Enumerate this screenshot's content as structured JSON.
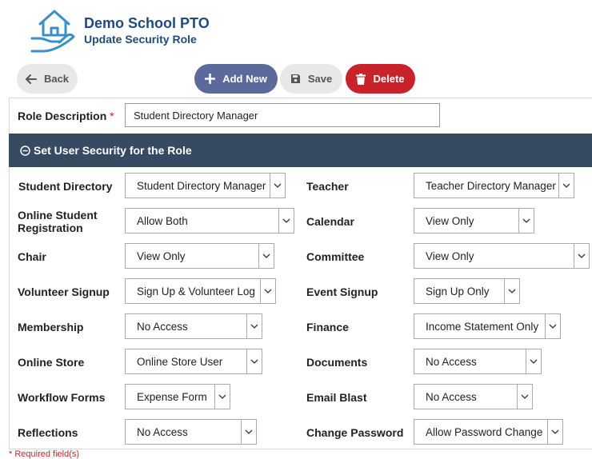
{
  "header": {
    "school_name": "Demo School PTO",
    "page_title": "Update Security Role"
  },
  "toolbar": {
    "back_label": "Back",
    "add_label": "Add New",
    "save_label": "Save",
    "delete_label": "Delete"
  },
  "form": {
    "role_description_label": "Role Description",
    "required_mark": "*",
    "role_description_value": "Student Directory Manager",
    "section_title": "Set User Security for the Role",
    "fields": {
      "student_directory": {
        "label": "Student Directory",
        "value": "Student Directory Manager"
      },
      "teacher": {
        "label": "Teacher",
        "value": "Teacher Directory Manager"
      },
      "online_student_registration": {
        "label_line1": "Online Student",
        "label_line2": "Registration",
        "value": "Allow Both"
      },
      "calendar": {
        "label": "Calendar",
        "value": "View Only"
      },
      "chair": {
        "label": "Chair",
        "value": "View Only"
      },
      "committee": {
        "label": "Committee",
        "value": "View Only"
      },
      "volunteer_signup": {
        "label": "Volunteer Signup",
        "value": "Sign Up & Volunteer Log"
      },
      "event_signup": {
        "label": "Event Signup",
        "value": "Sign Up Only"
      },
      "membership": {
        "label": "Membership",
        "value": "No Access"
      },
      "finance": {
        "label": "Finance",
        "value": "Income Statement Only"
      },
      "online_store": {
        "label": "Online Store",
        "value": "Online Store User"
      },
      "documents": {
        "label": "Documents",
        "value": "No Access"
      },
      "workflow_forms": {
        "label": "Workflow Forms",
        "value": "Expense Form"
      },
      "email_blast": {
        "label": "Email Blast",
        "value": "No Access"
      },
      "reflections": {
        "label": "Reflections",
        "value": "No Access"
      },
      "change_password": {
        "label": "Change Password",
        "value": "Allow Password Change"
      }
    }
  },
  "footer": {
    "note": "* Required field(s)"
  },
  "colors": {
    "brand_text": "#1e4b7a",
    "add_button": "#5b6a9a",
    "delete_button": "#c8232a",
    "section_bar": "#364a61",
    "logo": "#3a8fc9"
  },
  "icons": {
    "logo": "house-in-hand-logo",
    "back": "arrow-left-icon",
    "add": "plus-icon",
    "save": "floppy-disk-icon",
    "delete": "trash-icon",
    "section": "minus-circle-icon",
    "dropdown": "chevron-down-icon"
  }
}
